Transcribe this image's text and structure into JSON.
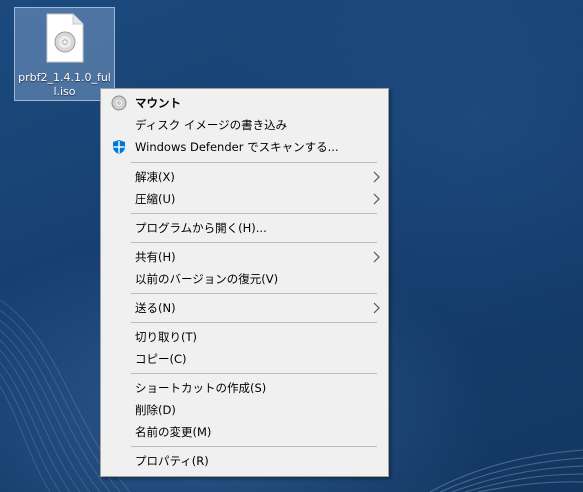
{
  "desktop": {
    "icon": {
      "label": "prbf2_1.4.1.0_full.iso",
      "icon_name": "disc-image-file-icon"
    }
  },
  "context_menu": {
    "items": [
      {
        "id": "mount",
        "label": "マウント",
        "bold": true,
        "icon": "disc-icon"
      },
      {
        "id": "burn",
        "label": "ディスク イメージの書き込み"
      },
      {
        "id": "defender",
        "label": "Windows Defender でスキャンする...",
        "icon": "windows-defender-icon"
      },
      {
        "id": "extract",
        "label": "解凍(X)",
        "submenu": true
      },
      {
        "id": "compress",
        "label": "圧縮(U)",
        "submenu": true
      },
      {
        "id": "open_with",
        "label": "プログラムから開く(H)..."
      },
      {
        "id": "share",
        "label": "共有(H)",
        "submenu": true
      },
      {
        "id": "restore",
        "label": "以前のバージョンの復元(V)"
      },
      {
        "id": "send_to",
        "label": "送る(N)",
        "submenu": true
      },
      {
        "id": "cut",
        "label": "切り取り(T)"
      },
      {
        "id": "copy",
        "label": "コピー(C)"
      },
      {
        "id": "shortcut",
        "label": "ショートカットの作成(S)"
      },
      {
        "id": "delete",
        "label": "削除(D)"
      },
      {
        "id": "rename",
        "label": "名前の変更(M)"
      },
      {
        "id": "properties",
        "label": "プロパティ(R)"
      }
    ]
  },
  "colors": {
    "desktop_bg": "#163f70",
    "menu_bg": "#f0f0f0",
    "defender_blue": "#0078d7"
  }
}
